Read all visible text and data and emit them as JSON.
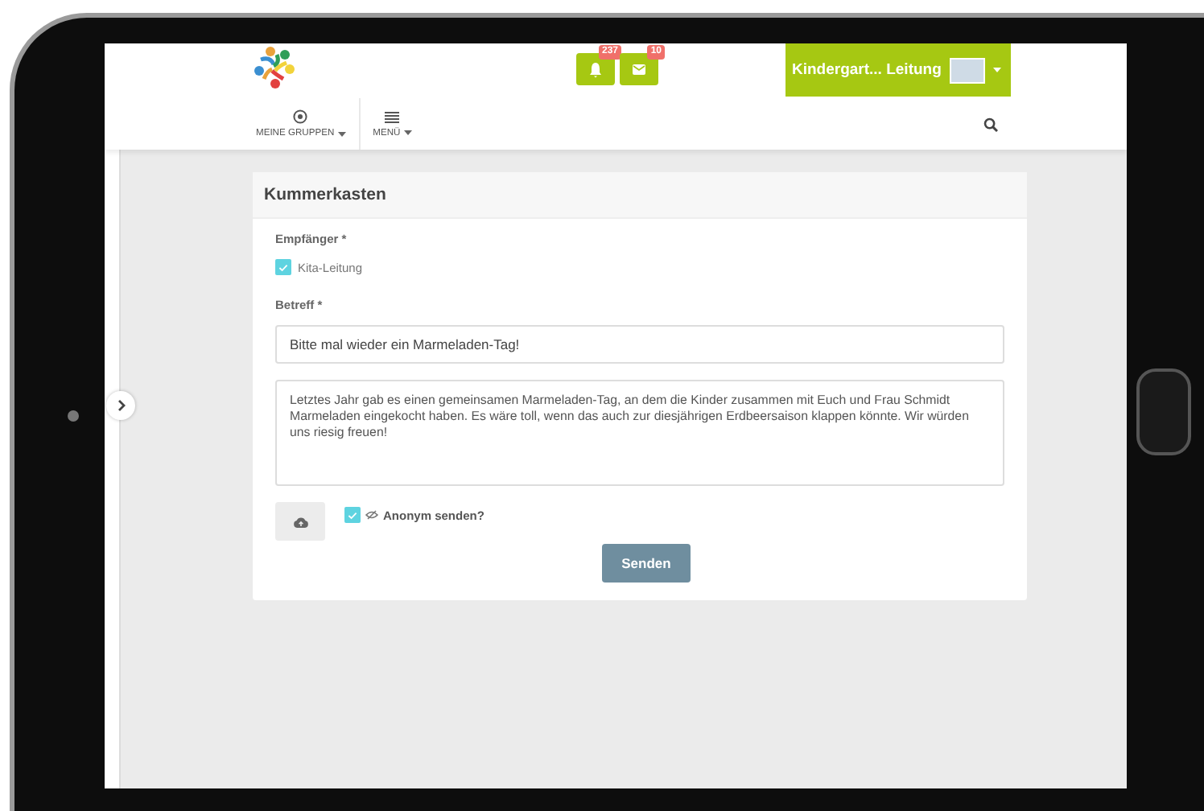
{
  "header": {
    "notifications": [
      {
        "kind": "bell",
        "count": "237"
      },
      {
        "kind": "mail",
        "count": "10"
      }
    ],
    "user_menu": {
      "label": "Kindergart... Leitung"
    },
    "nav": [
      {
        "kind": "groups",
        "label": "MEINE GRUPPEN"
      },
      {
        "kind": "menu",
        "label": "MENÜ"
      }
    ]
  },
  "form": {
    "title": "Kummerkasten",
    "recipient_label": "Empfänger *",
    "recipients": [
      {
        "label": "Kita-Leitung",
        "checked": true
      }
    ],
    "subject_label": "Betreff *",
    "subject": "Bitte mal wieder ein Marmeladen-Tag!",
    "message": "Letztes Jahr gab es einen gemeinsamen Marmeladen-Tag, an dem die Kinder zusammen mit Euch und Frau Schmidt Marmeladen eingekocht haben. Es wäre toll, wenn das auch zur diesjährigen Erdbeersaison klappen könnte. Wir würden uns riesig freuen!",
    "anonymous": {
      "label": "Anonym senden?",
      "checked": true
    },
    "submit": "Senden"
  }
}
